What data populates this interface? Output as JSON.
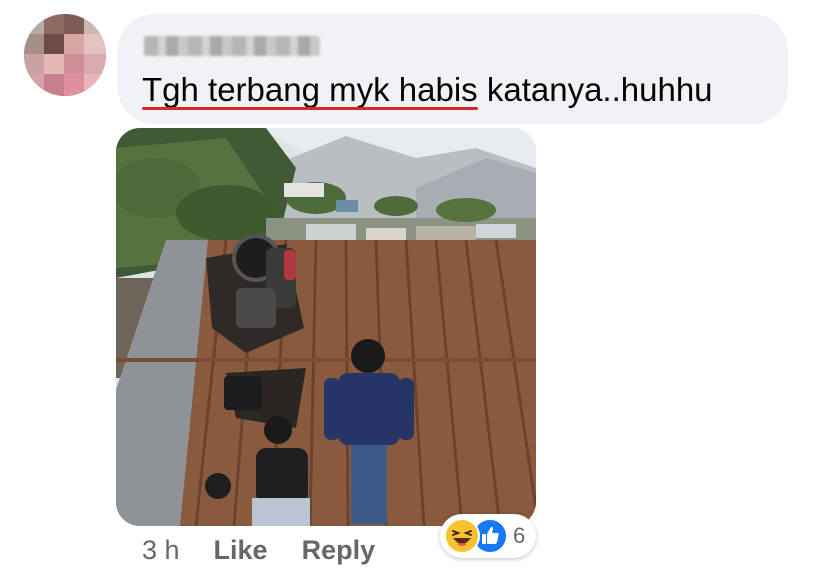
{
  "comment": {
    "underlined_text": "Tgh terbang myk habis",
    "rest_text": " katanya..huhhu",
    "underline_color": "#e0242b"
  },
  "meta": {
    "time": "3 h",
    "like_label": "Like",
    "reply_label": "Reply"
  },
  "reactions": {
    "icons": [
      "haha-reaction-icon",
      "like-reaction-icon"
    ],
    "count": "6"
  },
  "colors": {
    "bubble": "#f0f2f5",
    "meta_text": "#65676b",
    "like_blue": "#1877f2",
    "haha_yellow": "#f7c12f"
  }
}
